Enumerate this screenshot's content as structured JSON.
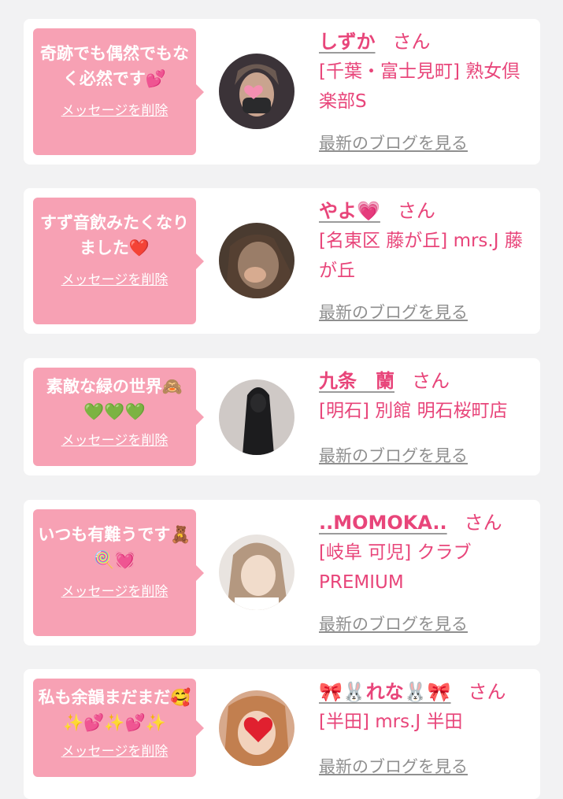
{
  "messages": [
    {
      "text": "奇跡でも偶然でもなく必然です💕",
      "delete_label": "メッセージを削除",
      "name": "しずか",
      "honorific": "さん",
      "shop": "[千葉・富士見町] 熟女倶楽部S",
      "blog_label": "最新のブログを見る"
    },
    {
      "text": "すず音飲みたくなりました❤️",
      "delete_label": "メッセージを削除",
      "name": "やよ💗",
      "honorific": "さん",
      "shop": "[名東区 藤が丘] mrs.J 藤が丘",
      "blog_label": "最新のブログを見る"
    },
    {
      "text": "素敵な緑の世界🙈💚💚💚",
      "delete_label": "メッセージを削除",
      "name": "九条　蘭",
      "honorific": "さん",
      "shop": "[明石] 別館 明石桜町店",
      "blog_label": "最新のブログを見る"
    },
    {
      "text": "いつも有難うです🧸🍭💓",
      "delete_label": "メッセージを削除",
      "name": "..MOMOKA..",
      "honorific": "さん",
      "shop": "[岐阜 可児] クラブ PREMIUM",
      "blog_label": "最新のブログを見る"
    },
    {
      "text": "私も余韻まだまだ🥰✨💕✨💕✨",
      "delete_label": "メッセージを削除",
      "name": "🎀🐰れな🐰🎀",
      "honorific": "さん",
      "shop": "[半田] mrs.J 半田",
      "blog_label": "最新のブログを見る"
    }
  ],
  "colors": {
    "bubble": "#f7a1b4",
    "accent": "#e8457a",
    "link_gray": "#8f8f8f",
    "page_bg": "#f2f2f3"
  }
}
